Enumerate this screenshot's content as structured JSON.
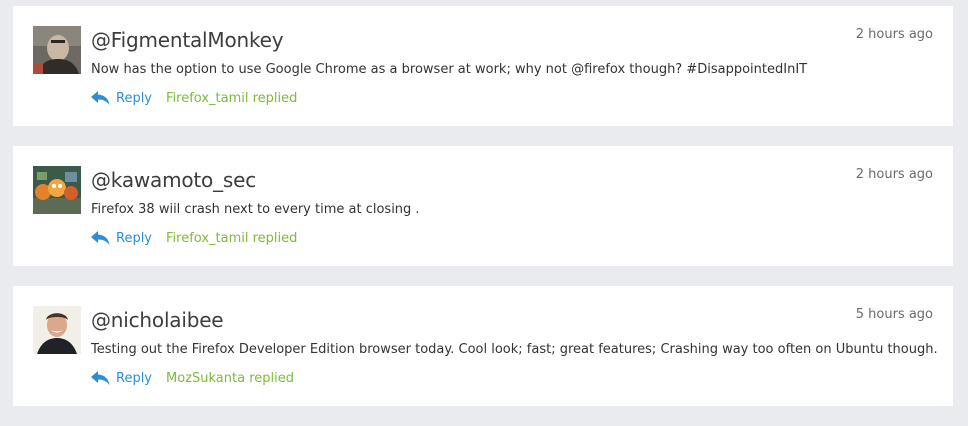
{
  "feed": {
    "items": [
      {
        "avatar": "person-dark-shirt",
        "handle": "@FigmentalMonkey",
        "time": "2 hours ago",
        "text": "Now has the option to use Google Chrome as a browser at work; why not @firefox though? #DisappointedInIT",
        "reply_label": "Reply",
        "replied_by": "Firefox_tamil replied"
      },
      {
        "avatar": "colorful-figurines",
        "handle": "@kawamoto_sec",
        "time": "2 hours ago",
        "text": "Firefox 38 wiil crash next to every time at closing .",
        "reply_label": "Reply",
        "replied_by": "Firefox_tamil replied"
      },
      {
        "avatar": "smiling-person",
        "handle": "@nicholaibee",
        "time": "5 hours ago",
        "text": "Testing out the Firefox Developer Edition browser today. Cool look; fast; great features; Crashing way too often on Ubuntu though.",
        "reply_label": "Reply",
        "replied_by": "MozSukanta replied"
      }
    ]
  },
  "colors": {
    "reply": "#2a8fd6",
    "replied": "#7dbb3a",
    "background": "#e9ebee",
    "card": "#ffffff"
  }
}
